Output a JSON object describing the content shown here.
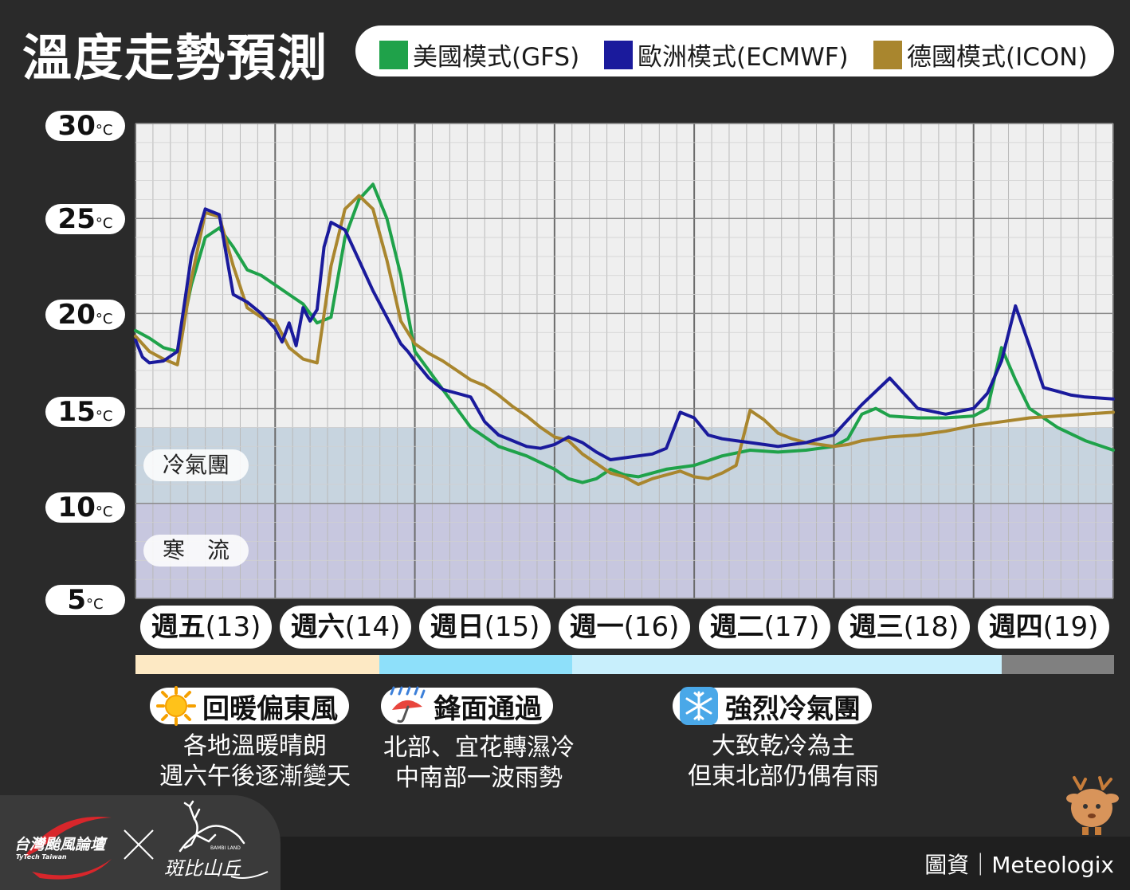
{
  "title": "溫度走勢預測",
  "legend": [
    {
      "label": "美國模式(GFS)",
      "color": "#1fa24a"
    },
    {
      "label": "歐洲模式(ECMWF)",
      "color": "#1a1a9c"
    },
    {
      "label": "德國模式(ICON)",
      "color": "#a9862e"
    }
  ],
  "y_ticks": [
    {
      "num": "30",
      "unit": "°C"
    },
    {
      "num": "25",
      "unit": "°C"
    },
    {
      "num": "20",
      "unit": "°C"
    },
    {
      "num": "15",
      "unit": "°C"
    },
    {
      "num": "10",
      "unit": "°C"
    },
    {
      "num": "5",
      "unit": "°C"
    }
  ],
  "zones": {
    "cold_air": "冷氣團",
    "cold_surge": "寒　流"
  },
  "days": [
    {
      "name": "週五",
      "date": "(13)"
    },
    {
      "name": "週六",
      "date": "(14)"
    },
    {
      "name": "週日",
      "date": "(15)"
    },
    {
      "name": "週一",
      "date": "(16)"
    },
    {
      "name": "週二",
      "date": "(17)"
    },
    {
      "name": "週三",
      "date": "(18)"
    },
    {
      "name": "週四",
      "date": "(19)"
    }
  ],
  "phase_bar_colors": [
    "#fde9c4",
    "#8ee0fa",
    "#c8effc",
    "#808080"
  ],
  "phases": [
    {
      "icon": "sun-icon",
      "title": "回暖偏東風",
      "lines": [
        "各地溫暖晴朗",
        "週六午後逐漸變天"
      ]
    },
    {
      "icon": "umbrella-rain-icon",
      "title": "鋒面通過",
      "lines": [
        "北部、宜花轉濕冷",
        "中南部一波雨勢"
      ]
    },
    {
      "icon": "snowflake-icon",
      "title": "強烈冷氣團",
      "lines": [
        "大致乾冷為主",
        "但東北部仍偶有雨"
      ]
    }
  ],
  "credit": "圖資｜Meteologix",
  "logos": {
    "left_text": "台灣颱風論壇",
    "left_sub": "TyTech Taiwan",
    "right_text": "斑比山丘",
    "right_sub": "BAMBI LAND"
  },
  "chart_data": {
    "type": "line",
    "ylim": [
      5,
      30
    ],
    "x_unit": "days from Fri 00h",
    "xlim": [
      0,
      7
    ],
    "zones": [
      {
        "label": "冷氣團",
        "from": 10,
        "to": 14
      },
      {
        "label": "寒　流",
        "from": 5,
        "to": 10
      }
    ],
    "series": [
      {
        "name": "美國模式(GFS)",
        "color": "#1fa24a",
        "x": [
          0,
          0.1,
          0.2,
          0.3,
          0.4,
          0.5,
          0.6,
          0.7,
          0.8,
          0.9,
          1.0,
          1.1,
          1.2,
          1.3,
          1.4,
          1.5,
          1.6,
          1.7,
          1.8,
          1.9,
          2.0,
          2.2,
          2.4,
          2.6,
          2.8,
          3.0,
          3.1,
          3.2,
          3.3,
          3.4,
          3.5,
          3.6,
          3.7,
          3.8,
          3.9,
          4.0,
          4.2,
          4.4,
          4.6,
          4.8,
          5.0,
          5.1,
          5.2,
          5.3,
          5.4,
          5.6,
          5.8,
          6.0,
          6.1,
          6.2,
          6.3,
          6.4,
          6.5,
          6.6,
          6.8,
          7.0
        ],
        "y": [
          19.1,
          18.7,
          18.2,
          18.0,
          21.5,
          24.0,
          24.5,
          23.5,
          22.3,
          22.0,
          21.5,
          21.0,
          20.5,
          19.5,
          19.8,
          24.0,
          26.0,
          26.8,
          25.0,
          22.0,
          18.0,
          16.0,
          14.0,
          13.0,
          12.5,
          11.8,
          11.3,
          11.1,
          11.3,
          11.8,
          11.5,
          11.4,
          11.6,
          11.8,
          11.9,
          12.0,
          12.5,
          12.8,
          12.7,
          12.8,
          13.0,
          13.4,
          14.7,
          15.0,
          14.6,
          14.5,
          14.5,
          14.6,
          15.0,
          18.2,
          16.5,
          15.0,
          14.5,
          14.0,
          13.3,
          12.8
        ]
      },
      {
        "name": "歐洲模式(ECMWF)",
        "color": "#1a1a9c",
        "x": [
          0,
          0.05,
          0.1,
          0.2,
          0.3,
          0.4,
          0.5,
          0.6,
          0.7,
          0.8,
          0.9,
          1.0,
          1.05,
          1.1,
          1.15,
          1.2,
          1.25,
          1.3,
          1.35,
          1.4,
          1.5,
          1.6,
          1.7,
          1.8,
          1.9,
          1.95,
          2.0,
          2.1,
          2.2,
          2.3,
          2.4,
          2.5,
          2.6,
          2.7,
          2.8,
          2.9,
          3.0,
          3.1,
          3.2,
          3.3,
          3.4,
          3.5,
          3.6,
          3.7,
          3.8,
          3.9,
          4.0,
          4.1,
          4.2,
          4.3,
          4.4,
          4.5,
          4.6,
          4.7,
          4.8,
          4.9,
          5.0,
          5.2,
          5.4,
          5.6,
          5.8,
          6.0,
          6.1,
          6.2,
          6.3,
          6.4,
          6.5,
          6.6,
          6.7,
          6.8,
          7.0
        ],
        "y": [
          18.6,
          17.7,
          17.4,
          17.5,
          18.0,
          23.0,
          25.5,
          25.2,
          21.0,
          20.6,
          20.0,
          19.2,
          18.5,
          19.5,
          18.3,
          20.3,
          19.6,
          20.2,
          23.5,
          24.8,
          24.4,
          22.8,
          21.2,
          19.8,
          18.4,
          18.0,
          17.5,
          16.6,
          16.0,
          15.8,
          15.6,
          14.3,
          13.6,
          13.3,
          13.0,
          12.9,
          13.1,
          13.5,
          13.2,
          12.7,
          12.3,
          12.4,
          12.5,
          12.6,
          12.9,
          14.8,
          14.5,
          13.6,
          13.4,
          13.3,
          13.2,
          13.1,
          13.0,
          13.1,
          13.2,
          13.4,
          13.6,
          15.2,
          16.6,
          15.0,
          14.7,
          15.0,
          15.8,
          17.5,
          20.4,
          18.3,
          16.1,
          15.9,
          15.7,
          15.6,
          15.5
        ]
      },
      {
        "name": "德國模式(ICON)",
        "color": "#a9862e",
        "x": [
          0,
          0.1,
          0.2,
          0.3,
          0.4,
          0.5,
          0.6,
          0.7,
          0.8,
          0.9,
          1.0,
          1.1,
          1.2,
          1.3,
          1.4,
          1.5,
          1.6,
          1.7,
          1.8,
          1.9,
          2.0,
          2.1,
          2.2,
          2.3,
          2.4,
          2.5,
          2.6,
          2.7,
          2.8,
          2.9,
          3.0,
          3.1,
          3.2,
          3.3,
          3.4,
          3.5,
          3.6,
          3.7,
          3.8,
          3.9,
          4.0,
          4.1,
          4.2,
          4.3,
          4.4,
          4.5,
          4.6,
          4.7,
          4.8,
          4.9,
          5.0,
          5.1,
          5.2,
          5.3,
          5.4,
          5.6,
          5.8,
          6.0,
          6.2,
          6.4,
          6.6,
          6.8,
          7.0
        ],
        "y": [
          18.8,
          18.0,
          17.6,
          17.3,
          21.8,
          25.3,
          25.1,
          22.5,
          20.3,
          19.8,
          19.6,
          18.2,
          17.6,
          17.4,
          22.5,
          25.5,
          26.2,
          25.5,
          22.8,
          19.6,
          18.4,
          17.9,
          17.5,
          17.0,
          16.5,
          16.2,
          15.7,
          15.1,
          14.6,
          14.0,
          13.5,
          13.3,
          12.6,
          12.1,
          11.6,
          11.4,
          11.0,
          11.3,
          11.5,
          11.7,
          11.4,
          11.3,
          11.6,
          12.0,
          14.9,
          14.4,
          13.7,
          13.4,
          13.2,
          13.1,
          13.0,
          13.1,
          13.3,
          13.4,
          13.5,
          13.6,
          13.8,
          14.1,
          14.3,
          14.5,
          14.6,
          14.7,
          14.8
        ]
      }
    ]
  }
}
